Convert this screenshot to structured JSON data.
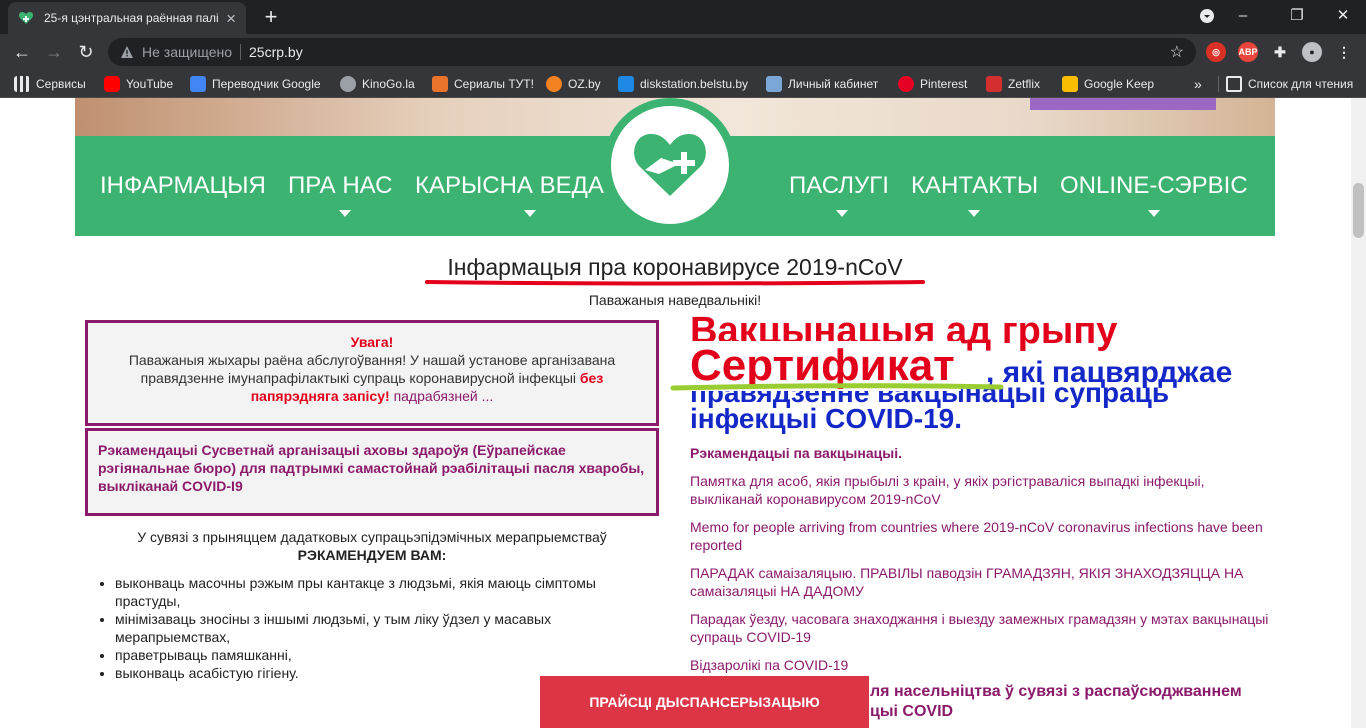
{
  "browser": {
    "tab_title": "25-я цэнтральная раённая палі",
    "address_security": "Не защищено",
    "address_url": "25crp.by",
    "bookmarks": [
      {
        "label": "Сервисы",
        "icon": "apps-grid-icon",
        "color": "#e8eaed"
      },
      {
        "label": "YouTube",
        "icon": "youtube-icon",
        "color": "#ff0000"
      },
      {
        "label": "Переводчик Google",
        "icon": "google-translate-icon",
        "color": "#4285f4"
      },
      {
        "label": "KinoGo.la",
        "icon": "kinogo-icon",
        "color": "#9aa0a6"
      },
      {
        "label": "Сериалы ТУТ!",
        "icon": "serials-icon",
        "color": "#e8752a"
      },
      {
        "label": "OZ.by",
        "icon": "oz-icon",
        "color": "#f58220"
      },
      {
        "label": "diskstation.belstu.by",
        "icon": "dsm-icon",
        "color": "#1e88e5"
      },
      {
        "label": "Личный кабинет",
        "icon": "cabinet-icon",
        "color": "#7aa7d6"
      },
      {
        "label": "Pinterest",
        "icon": "pinterest-icon",
        "color": "#e60023"
      },
      {
        "label": "Zetflix",
        "icon": "zetflix-icon",
        "color": "#d32f2f"
      },
      {
        "label": "Google Keep",
        "icon": "google-keep-icon",
        "color": "#fbbc04"
      }
    ],
    "overflow": "»",
    "reading_list": "Список для чтения"
  },
  "nav": {
    "items_left": [
      "ІНФАРМАЦЫЯ",
      "ПРА НАС",
      "КАРЫСНА ВЕДА"
    ],
    "items_right": [
      "ПАСЛУГІ",
      "КАНТАКТЫ",
      "ONLINE-СЭРВІС"
    ]
  },
  "content": {
    "title": "Інфармацыя пра коронавирусе 2019-nCoV",
    "subtitle": "Паважаныя наведвальнікі!",
    "box1": {
      "heading": "Увага!",
      "text": "Паважаныя жыхары раёна абслугоўвання! У нашай установе арганізавана правядзенне імунапрафілактыкі супраць коронавирусной інфекцыі",
      "highlight": "без папярэдняга запісу!",
      "more": "падрабязней ..."
    },
    "box2": "Рэкамендацыі Сусветнай арганізацыі аховы здароўя (Еўрапейскае рэгіянальнае бюро) для падтрымкі самастойнай рэабілітацыі пасля хваробы, выкліканай COVID-I9",
    "intro_text": "У сувязі з прыняццем дадатковых супрацьэпідэмічных мерапрыемстваў",
    "intro_bold": "РЭКАМЕНДУЕМ ВАМ:",
    "recommendations": [
      "выконваць масочны рэжым пры кантакце з людзьмі, якія маюць сімптомы прастуды,",
      "мінімізаваць зносіны з іншымі людзьмі, у тым ліку ўдзел у масавых мерапрыемствах,",
      "праветрываць памяшканні,",
      "выконваць асабістую гігіену."
    ],
    "vaccination_heading": "Вакцынацыя ад грыпу",
    "blue_text_line1": "правядзенне вакцынацыі супраць",
    "blue_text_line2": "інфекцыі COVID-19.",
    "certificate_word": "Сертификат",
    "certificate_tail": ", які пацвярджае",
    "links_heading": "Рэкамендацыі па вакцынацыі.",
    "links": [
      "Памятка для асоб, якія прыбылі з краін, у якіх рэгістраваліся выпадкі інфекцыі, выкліканай коронавирусом 2019-nCoV",
      "Memo for people arriving from countries where 2019-nCoV coronavirus infections have been reported",
      "ПАРАДАК самаізаляцыю. ПРАВІЛЫ паводзін ГРАМАДЗЯН, ЯКІЯ ЗНАХОДЗЯЦЦА НА самаізаляцыі НА ДАДОМУ",
      "Парадак ўезду, часовага знаходжання і выезду замежных грамадзян у мэтах вакцынацыі супраць COVID-19",
      "Відзаролікі па COVID-19"
    ],
    "cut_text_line1": "ля насельніцтва ў сувязі з распаўсюджваннем",
    "cut_text_line2": "цыі COVID",
    "cta": "ПРАЙСЦІ ДЫСПАНСЕРЫЗАЦЫЮ"
  },
  "colors": {
    "nav_green": "#3cb371",
    "brand_purple": "#8b1a6b",
    "alert_red": "#e3001b",
    "cta_red": "#dc3545",
    "blue_text": "#1428c8"
  }
}
